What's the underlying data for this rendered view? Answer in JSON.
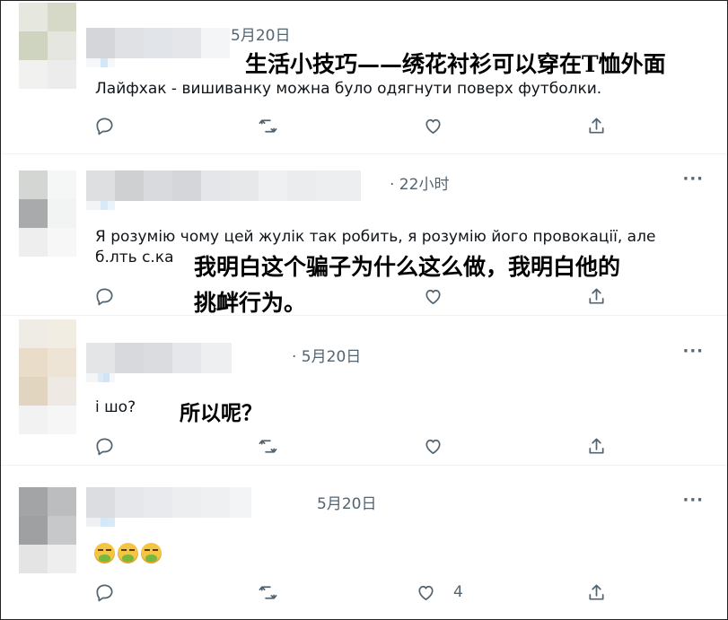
{
  "tweets": [
    {
      "time": "5月20日",
      "text": "Лайфхак - вишиванку можна було одягнути поверх футболки.",
      "overlay_caption": "生活小技巧——绣花衬衫可以穿在T恤外面",
      "likes": ""
    },
    {
      "time": "· 22小时",
      "text_line1": "Я розумію чому цей жулік так робить, я розумію його провокації, але",
      "text_line2": "б.лть с.ка",
      "overlay_caption_line1": "我明白这个骗子为什么这么做，我明白他的",
      "overlay_caption_line2": "挑衅行为。",
      "more_icon": "more-icon"
    },
    {
      "time": "· 5月20日",
      "text": "і шо?",
      "overlay_caption": "所以呢？",
      "more_icon": "more-icon"
    },
    {
      "time": "5月20日",
      "emoji": [
        "nauseated-face",
        "nauseated-face",
        "nauseated-face"
      ],
      "likes": "4",
      "more_icon": "more-icon"
    }
  ],
  "more_glyph": "···",
  "action_icons": [
    "reply-icon",
    "retweet-icon",
    "like-icon",
    "share-icon"
  ],
  "colors": {
    "muted": "#536471",
    "text": "#0f1419",
    "divider": "#eff3f4",
    "emoji_face": "#f4c542",
    "emoji_green": "#78b83e"
  }
}
